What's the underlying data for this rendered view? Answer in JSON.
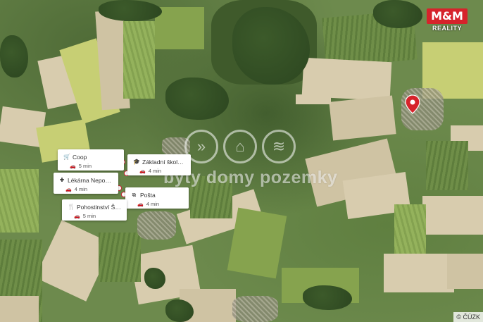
{
  "map": {
    "watermark_icons": [
      "arrows-right-icon",
      "house-roof-icon",
      "chevrons-down-icon"
    ],
    "watermark_text": "byty domy pozemky",
    "brand": {
      "logo_text": "M&M",
      "logo_subtext": "REALITY",
      "color": "#d6232b"
    },
    "pin_color": "#d6232b",
    "copyright": "© ČÚZK"
  },
  "pois": [
    {
      "icon": "cart-icon",
      "glyph": "🛒",
      "name": "Coop",
      "time": "5 min"
    },
    {
      "icon": "graduation-cap-icon",
      "glyph": "🎓",
      "name": "Základní škola a ...",
      "time": "4 min"
    },
    {
      "icon": "medical-cross-icon",
      "glyph": "✚",
      "name": "Lékárna Nepomu...",
      "time": "4 min"
    },
    {
      "icon": "post-office-icon",
      "glyph": "⧉",
      "name": "Pošta",
      "time": "4 min"
    },
    {
      "icon": "fork-knife-icon",
      "glyph": "🍴",
      "name": "Pohostinství Šimá...",
      "time": "5 min"
    }
  ]
}
